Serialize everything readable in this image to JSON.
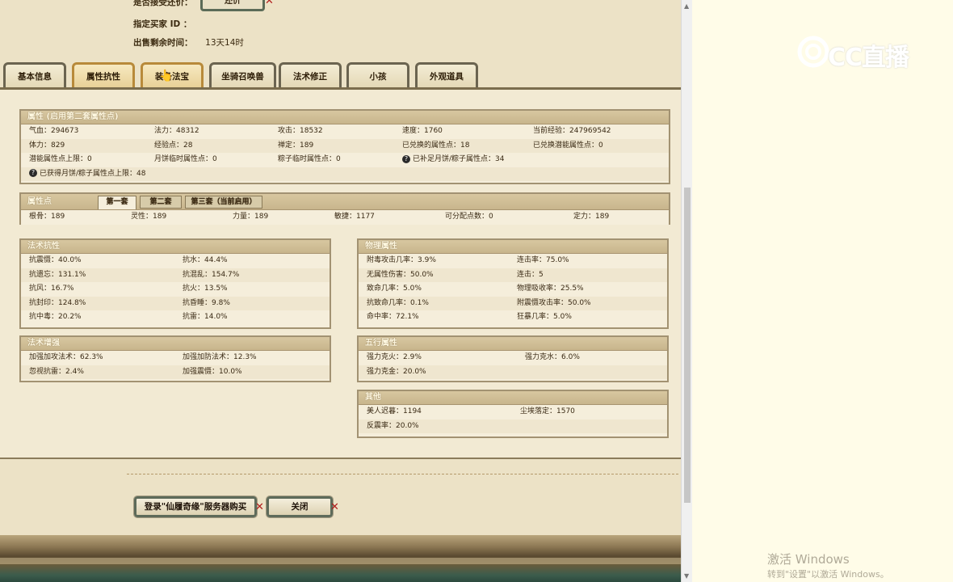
{
  "header": {
    "counteroffer_label": "是否接受还价：",
    "counteroffer_button": "还价",
    "buyer_id_label": "指定买家 ID ：",
    "buyer_id_value": "",
    "time_left_label": "出售剩余时间：",
    "time_left_value": "13天14时"
  },
  "tabs": [
    {
      "label": "基本信息",
      "active": false
    },
    {
      "label": "属性抗性",
      "active": true
    },
    {
      "label": "装备法宝",
      "active": false
    },
    {
      "label": "坐骑召唤兽",
      "active": false
    },
    {
      "label": "法术修正",
      "active": false
    },
    {
      "label": "小孩",
      "active": false
    },
    {
      "label": "外观道具",
      "active": false
    }
  ],
  "attributes": {
    "title": "属性 (启用第二套属性点)",
    "rows": [
      [
        "气血：294673",
        "法力：48312",
        "攻击：18532",
        "速度：1760",
        "当前经验：247969542"
      ],
      [
        "体力：829",
        "经验点：28",
        "禅定：189",
        "已兑换的属性点：18",
        "已兑换潜能属性点：0"
      ],
      [
        "潜能属性点上限：0",
        "月饼临时属性点：0",
        "粽子临时属性点：0",
        "已补足月饼/粽子属性点：34",
        ""
      ],
      [
        "已获得月饼/粽子属性点上限：48",
        "",
        "",
        "",
        ""
      ]
    ]
  },
  "attr_points": {
    "title": "属性点",
    "subtabs": [
      "第一套",
      "第二套",
      "第三套（当前启用）"
    ],
    "values": [
      "根骨：189",
      "灵性：189",
      "力量：189",
      "敏捷：1177",
      "可分配点数：0",
      "定力：189"
    ]
  },
  "magic_resist": {
    "title": "法术抗性",
    "rows": [
      [
        "抗震慑：40.0%",
        "抗水：44.4%"
      ],
      [
        "抗遗忘：131.1%",
        "抗混乱：154.7%"
      ],
      [
        "抗风：16.7%",
        "抗火：13.5%"
      ],
      [
        "抗封印：124.8%",
        "抗昏睡：9.8%"
      ],
      [
        "抗中毒：20.2%",
        "抗雷：14.0%"
      ]
    ]
  },
  "physical": {
    "title": "物理属性",
    "rows": [
      [
        "附毒攻击几率：3.9%",
        "连击率：75.0%"
      ],
      [
        "无属性伤害：50.0%",
        "连击：5"
      ],
      [
        "致命几率：5.0%",
        "物理吸收率：25.5%"
      ],
      [
        "抗致命几率：0.1%",
        "附震慑攻击率：50.0%"
      ],
      [
        "命中率：72.1%",
        "狂暴几率：5.0%"
      ]
    ]
  },
  "magic_boost": {
    "title": "法术增强",
    "rows": [
      [
        "加强加攻法术：62.3%",
        "加强加防法术：12.3%"
      ],
      [
        "忽视抗雷：2.4%",
        "加强震慑：10.0%"
      ]
    ]
  },
  "five_elements": {
    "title": "五行属性",
    "rows": [
      [
        "强力克火：2.9%",
        "强力克水：6.0%"
      ],
      [
        "强力克金：20.0%",
        ""
      ]
    ]
  },
  "other": {
    "title": "其他",
    "rows": [
      [
        "美人迟暮：1194",
        "尘埃落定：1570"
      ],
      [
        "反震率：20.0%",
        ""
      ]
    ]
  },
  "buttons": {
    "login_buy": "登录\"仙履奇缘\"服务器购买",
    "close": "关闭"
  },
  "watermark": {
    "logo_text": "CC直播",
    "windows_activate": "激活 Windows",
    "windows_hint": "转到\"设置\"以激活 Windows。"
  }
}
